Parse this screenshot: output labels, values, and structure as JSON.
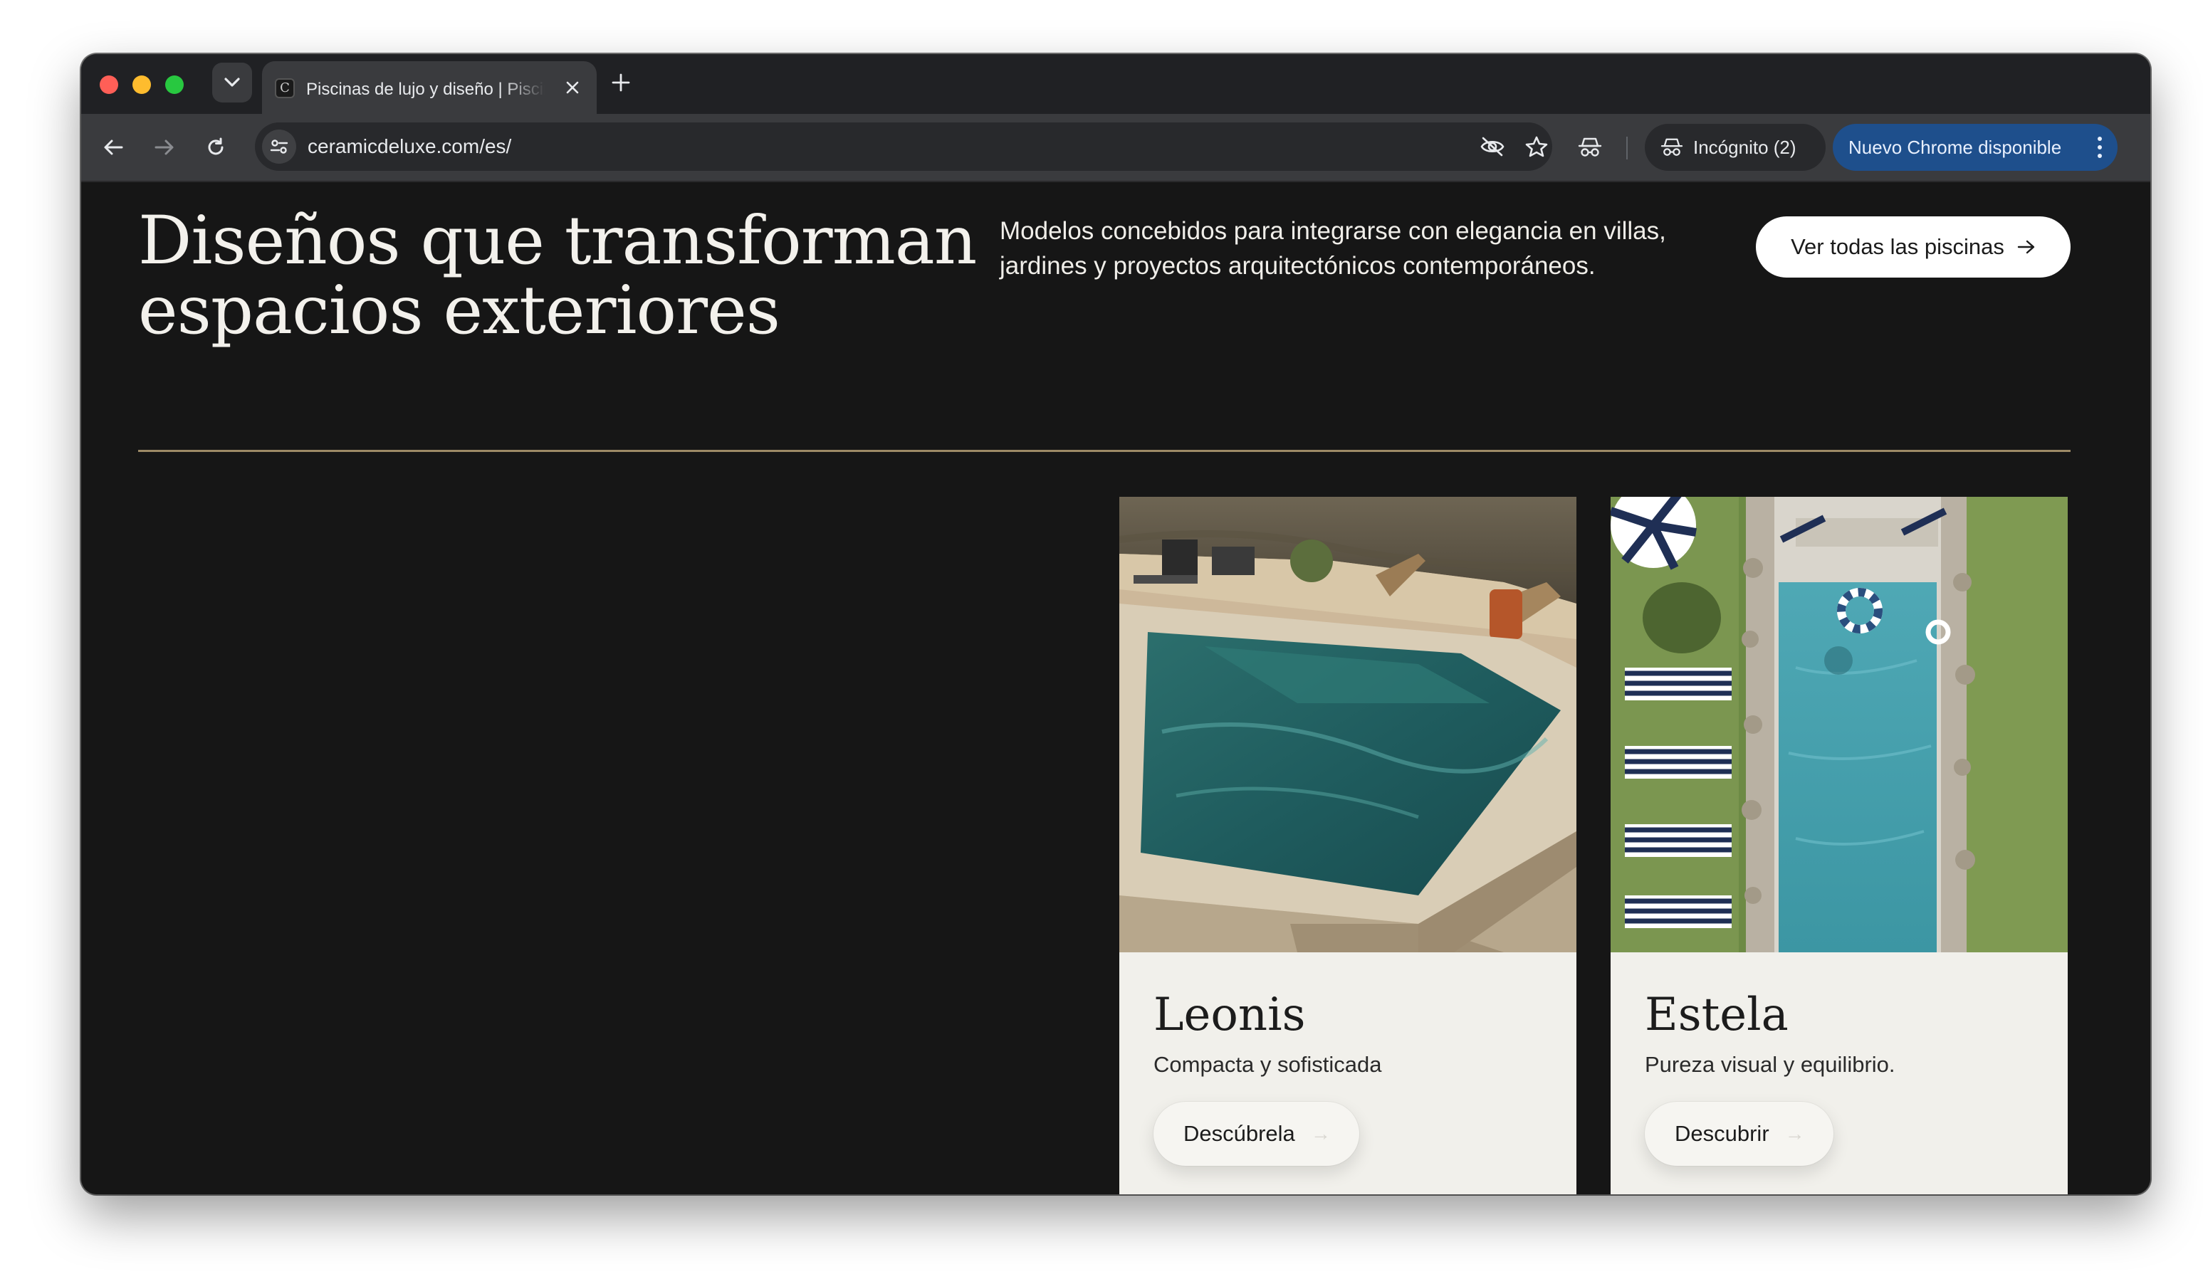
{
  "browser": {
    "tab": {
      "title": "Piscinas de lujo y diseño | Piscinas Ceramic Deluxe",
      "favicon": "C"
    },
    "address_bar": {
      "url": "ceramicdeluxe.com/es/"
    },
    "incognito_label": "Incógnito (2)",
    "update_label": "Nuevo Chrome disponible"
  },
  "hero": {
    "title_line1": "Diseños que transforman",
    "title_line2": "espacios exteriores",
    "description_line1": "Modelos concebidos para integrarse con elegancia en villas,",
    "description_line2": "jardines y proyectos arquitectónicos contemporáneos.",
    "cta_label": "Ver todas las piscinas"
  },
  "cards": [
    {
      "title": "Leonis",
      "subtitle": "Compacta y sofisticada",
      "button_label": "Descúbrela"
    },
    {
      "title": "Estela",
      "subtitle": "Pureza visual y equilibrio.",
      "button_label": "Descubrir"
    }
  ],
  "colors": {
    "page_background": "#161616",
    "divider_gold": "#9d8a66",
    "card_background": "#f1f0eb",
    "update_chip_blue": "#1e4f8c"
  }
}
